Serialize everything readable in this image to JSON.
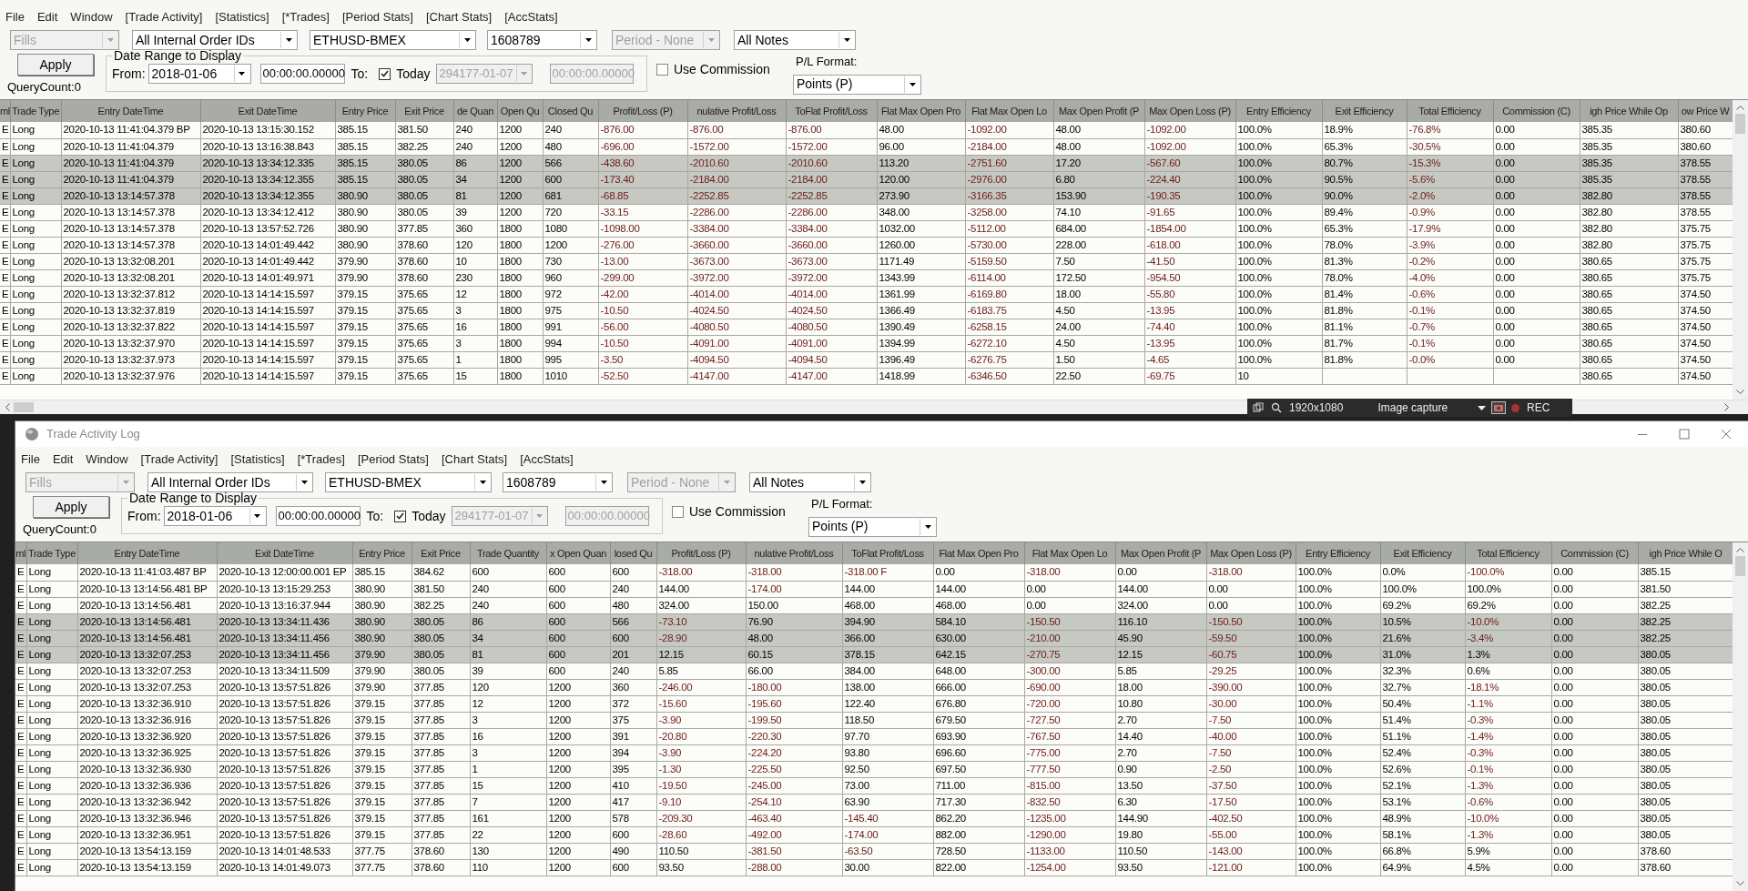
{
  "windows": [
    {
      "menu": [
        "File",
        "Edit",
        "Window",
        "[Trade Activity]",
        "[Statistics]",
        "[*Trades]",
        "[Period Stats]",
        "[Chart Stats]",
        "[AccStats]"
      ],
      "filters": [
        {
          "value": "Fills",
          "disabled": true
        },
        {
          "value": "All Internal Order IDs",
          "disabled": false
        },
        {
          "value": "ETHUSD-BMEX",
          "disabled": false
        },
        {
          "value": "1608789",
          "disabled": false
        },
        {
          "value": "Period - None",
          "disabled": true
        },
        {
          "value": "All Notes",
          "disabled": false
        }
      ],
      "apply_button": "Apply",
      "query_count": "QueryCount:0",
      "date_range": {
        "title": "Date Range to Display",
        "from_label": "From:",
        "from_date": "2018-01-06",
        "from_time": "00:00:00.00000",
        "to_label": "To:",
        "today": {
          "label": "Today",
          "checked": true
        },
        "to_date": {
          "value": "294177-01-07",
          "disabled": true
        },
        "to_time": {
          "value": "00:00:00.00000",
          "disabled": true
        }
      },
      "use_commission": {
        "label": "Use Commission",
        "checked": false
      },
      "pl_format": {
        "label": "P/L Format:",
        "value": "Points (P)"
      },
      "table": {
        "columns": [
          "ml",
          "Trade Type",
          "Entry DateTime",
          "Exit DateTime",
          "Entry Price",
          "Exit Price",
          "de Quan",
          "Open Qu",
          "Closed Qu",
          "Profit/Loss (P)",
          "nulative Profit/Loss",
          "ToFlat Profit/Loss",
          "Flat Max Open Pro",
          "Flat Max Open Lo",
          "Max Open Profit (P",
          "Max Open Loss (P)",
          "Entry Efficiency",
          "Exit Efficiency",
          "Total Efficiency",
          "Commission (C)",
          "igh Price While Op",
          "ow Price W"
        ],
        "rows": [
          {
            "selected": false,
            "cells": [
              "E",
              "Long",
              "2020-10-13 11:41:04.379 BP",
              "2020-10-13 13:15:30.152",
              "385.15",
              "381.50",
              "240",
              "1200",
              "240",
              "-876.00",
              "-876.00",
              "-876.00",
              "48.00",
              "-1092.00",
              "48.00",
              "-1092.00",
              "100.0%",
              "18.9%",
              "-76.8%",
              "0.00",
              "385.35",
              "380.60"
            ]
          },
          {
            "selected": false,
            "cells": [
              "E",
              "Long",
              "2020-10-13 11:41:04.379",
              "2020-10-13 13:16:38.843",
              "385.15",
              "382.25",
              "240",
              "1200",
              "480",
              "-696.00",
              "-1572.00",
              "-1572.00",
              "96.00",
              "-2184.00",
              "48.00",
              "-1092.00",
              "100.0%",
              "65.3%",
              "-30.5%",
              "0.00",
              "385.35",
              "380.60"
            ]
          },
          {
            "selected": true,
            "cells": [
              "E",
              "Long",
              "2020-10-13 11:41:04.379",
              "2020-10-13 13:34:12.335",
              "385.15",
              "380.05",
              "86",
              "1200",
              "566",
              "-438.60",
              "-2010.60",
              "-2010.60",
              "113.20",
              "-2751.60",
              "17.20",
              "-567.60",
              "100.0%",
              "80.7%",
              "-15.3%",
              "0.00",
              "385.35",
              "378.55"
            ]
          },
          {
            "selected": true,
            "cells": [
              "E",
              "Long",
              "2020-10-13 11:41:04.379",
              "2020-10-13 13:34:12.355",
              "385.15",
              "380.05",
              "34",
              "1200",
              "600",
              "-173.40",
              "-2184.00",
              "-2184.00",
              "120.00",
              "-2976.00",
              "6.80",
              "-224.40",
              "100.0%",
              "90.5%",
              "-5.6%",
              "0.00",
              "385.35",
              "378.55"
            ]
          },
          {
            "selected": true,
            "cells": [
              "E",
              "Long",
              "2020-10-13 13:14:57.378",
              "2020-10-13 13:34:12.355",
              "380.90",
              "380.05",
              "81",
              "1200",
              "681",
              "-68.85",
              "-2252.85",
              "-2252.85",
              "273.90",
              "-3166.35",
              "153.90",
              "-190.35",
              "100.0%",
              "90.0%",
              "-2.0%",
              "0.00",
              "382.80",
              "378.55"
            ]
          },
          {
            "selected": false,
            "cells": [
              "E",
              "Long",
              "2020-10-13 13:14:57.378",
              "2020-10-13 13:34:12.412",
              "380.90",
              "380.05",
              "39",
              "1200",
              "720",
              "-33.15",
              "-2286.00",
              "-2286.00",
              "348.00",
              "-3258.00",
              "74.10",
              "-91.65",
              "100.0%",
              "89.4%",
              "-0.9%",
              "0.00",
              "382.80",
              "378.55"
            ]
          },
          {
            "selected": false,
            "cells": [
              "E",
              "Long",
              "2020-10-13 13:14:57.378",
              "2020-10-13 13:57:52.726",
              "380.90",
              "377.85",
              "360",
              "1800",
              "1080",
              "-1098.00",
              "-3384.00",
              "-3384.00",
              "1032.00",
              "-5112.00",
              "684.00",
              "-1854.00",
              "100.0%",
              "65.3%",
              "-17.9%",
              "0.00",
              "382.80",
              "375.75"
            ]
          },
          {
            "selected": false,
            "cells": [
              "E",
              "Long",
              "2020-10-13 13:14:57.378",
              "2020-10-13 14:01:49.442",
              "380.90",
              "378.60",
              "120",
              "1800",
              "1200",
              "-276.00",
              "-3660.00",
              "-3660.00",
              "1260.00",
              "-5730.00",
              "228.00",
              "-618.00",
              "100.0%",
              "78.0%",
              "-3.9%",
              "0.00",
              "382.80",
              "375.75"
            ]
          },
          {
            "selected": false,
            "cells": [
              "E",
              "Long",
              "2020-10-13 13:32:08.201",
              "2020-10-13 14:01:49.442",
              "379.90",
              "378.60",
              "10",
              "1800",
              "730",
              "-13.00",
              "-3673.00",
              "-3673.00",
              "1171.49",
              "-5159.50",
              "7.50",
              "-41.50",
              "100.0%",
              "81.3%",
              "-0.2%",
              "0.00",
              "380.65",
              "375.75"
            ]
          },
          {
            "selected": false,
            "cells": [
              "E",
              "Long",
              "2020-10-13 13:32:08.201",
              "2020-10-13 14:01:49.971",
              "379.90",
              "378.60",
              "230",
              "1800",
              "960",
              "-299.00",
              "-3972.00",
              "-3972.00",
              "1343.99",
              "-6114.00",
              "172.50",
              "-954.50",
              "100.0%",
              "78.0%",
              "-4.0%",
              "0.00",
              "380.65",
              "375.75"
            ]
          },
          {
            "selected": false,
            "cells": [
              "E",
              "Long",
              "2020-10-13 13:32:37.812",
              "2020-10-13 14:14:15.597",
              "379.15",
              "375.65",
              "12",
              "1800",
              "972",
              "-42.00",
              "-4014.00",
              "-4014.00",
              "1361.99",
              "-6169.80",
              "18.00",
              "-55.80",
              "100.0%",
              "81.4%",
              "-0.6%",
              "0.00",
              "380.65",
              "374.50"
            ]
          },
          {
            "selected": false,
            "cells": [
              "E",
              "Long",
              "2020-10-13 13:32:37.819",
              "2020-10-13 14:14:15.597",
              "379.15",
              "375.65",
              "3",
              "1800",
              "975",
              "-10.50",
              "-4024.50",
              "-4024.50",
              "1366.49",
              "-6183.75",
              "4.50",
              "-13.95",
              "100.0%",
              "81.8%",
              "-0.1%",
              "0.00",
              "380.65",
              "374.50"
            ]
          },
          {
            "selected": false,
            "cells": [
              "E",
              "Long",
              "2020-10-13 13:32:37.822",
              "2020-10-13 14:14:15.597",
              "379.15",
              "375.65",
              "16",
              "1800",
              "991",
              "-56.00",
              "-4080.50",
              "-4080.50",
              "1390.49",
              "-6258.15",
              "24.00",
              "-74.40",
              "100.0%",
              "81.1%",
              "-0.7%",
              "0.00",
              "380.65",
              "374.50"
            ]
          },
          {
            "selected": false,
            "cells": [
              "E",
              "Long",
              "2020-10-13 13:32:37.970",
              "2020-10-13 14:14:15.597",
              "379.15",
              "375.65",
              "3",
              "1800",
              "994",
              "-10.50",
              "-4091.00",
              "-4091.00",
              "1394.99",
              "-6272.10",
              "4.50",
              "-13.95",
              "100.0%",
              "81.7%",
              "-0.1%",
              "0.00",
              "380.65",
              "374.50"
            ]
          },
          {
            "selected": false,
            "cells": [
              "E",
              "Long",
              "2020-10-13 13:32:37.973",
              "2020-10-13 14:14:15.597",
              "379.15",
              "375.65",
              "1",
              "1800",
              "995",
              "-3.50",
              "-4094.50",
              "-4094.50",
              "1396.49",
              "-6276.75",
              "1.50",
              "-4.65",
              "100.0%",
              "81.8%",
              "-0.0%",
              "0.00",
              "380.65",
              "374.50"
            ]
          },
          {
            "selected": false,
            "cells": [
              "E",
              "Long",
              "2020-10-13 13:32:37.976",
              "2020-10-13 14:14:15.597",
              "379.15",
              "375.65",
              "15",
              "1800",
              "1010",
              "-52.50",
              "-4147.00",
              "-4147.00",
              "1418.99",
              "-6346.50",
              "22.50",
              "-69.75",
              "10",
              null,
              null,
              null,
              "380.65",
              "374.50"
            ]
          }
        ]
      }
    },
    {
      "title": "Trade Activity Log",
      "menu": [
        "File",
        "Edit",
        "Window",
        "[Trade Activity]",
        "[Statistics]",
        "[*Trades]",
        "[Period Stats]",
        "[Chart Stats]",
        "[AccStats]"
      ],
      "filters": [
        {
          "value": "Fills",
          "disabled": true
        },
        {
          "value": "All Internal Order IDs",
          "disabled": false
        },
        {
          "value": "ETHUSD-BMEX",
          "disabled": false
        },
        {
          "value": "1608789",
          "disabled": false
        },
        {
          "value": "Period - None",
          "disabled": true
        },
        {
          "value": "All Notes",
          "disabled": false
        }
      ],
      "apply_button": "Apply",
      "query_count": "QueryCount:0",
      "date_range": {
        "title": "Date Range to Display",
        "from_label": "From:",
        "from_date": "2018-01-06",
        "from_time": "00:00:00.00000",
        "to_label": "To:",
        "today": {
          "label": "Today",
          "checked": true
        },
        "to_date": {
          "value": "294177-01-07",
          "disabled": true
        },
        "to_time": {
          "value": "00:00:00.00000",
          "disabled": true
        }
      },
      "use_commission": {
        "label": "Use Commission",
        "checked": false
      },
      "pl_format": {
        "label": "P/L Format:",
        "value": "Points (P)"
      },
      "table": {
        "columns": [
          "ml",
          "Trade Type",
          "Entry DateTime",
          "Exit DateTime",
          "Entry Price",
          "Exit Price",
          "Trade Quantity",
          "x Open Quan",
          "losed Qu",
          "Profit/Loss (P)",
          "nulative Profit/Loss",
          "ToFlat Profit/Loss",
          "Flat Max Open Pro",
          "Flat Max Open Lo",
          "Max Open Profit (P",
          "Max Open Loss (P)",
          "Entry Efficiency",
          "Exit Efficiency",
          "Total Efficiency",
          "Commission (C)",
          "igh Price While O"
        ],
        "rows": [
          {
            "selected": false,
            "cells": [
              "E",
              "Long",
              "2020-10-13 11:41:03.487 BP",
              "2020-10-13 12:00:00.001 EP",
              "385.15",
              "384.62",
              "600",
              "600",
              "600",
              "-318.00",
              "-318.00",
              "-318.00 F",
              "0.00",
              "-318.00",
              "0.00",
              "-318.00",
              "100.0%",
              "0.0%",
              "-100.0%",
              "0.00",
              "385.15"
            ]
          },
          {
            "selected": false,
            "cells": [
              "E",
              "Long",
              "2020-10-13 13:14:56.481 BP",
              "2020-10-13 13:15:29.253",
              "380.90",
              "381.50",
              "240",
              "600",
              "240",
              "144.00",
              "-174.00",
              "144.00",
              "144.00",
              "0.00",
              "144.00",
              "0.00",
              "100.0%",
              "100.0%",
              "100.0%",
              "0.00",
              "381.50"
            ]
          },
          {
            "selected": false,
            "cells": [
              "E",
              "Long",
              "2020-10-13 13:14:56.481",
              "2020-10-13 13:16:37.944",
              "380.90",
              "382.25",
              "240",
              "600",
              "480",
              "324.00",
              "150.00",
              "468.00",
              "468.00",
              "0.00",
              "324.00",
              "0.00",
              "100.0%",
              "69.2%",
              "69.2%",
              "0.00",
              "382.25"
            ]
          },
          {
            "selected": true,
            "cells": [
              "E",
              "Long",
              "2020-10-13 13:14:56.481",
              "2020-10-13 13:34:11.436",
              "380.90",
              "380.05",
              "86",
              "600",
              "566",
              "-73.10",
              "76.90",
              "394.90",
              "584.10",
              "-150.50",
              "116.10",
              "-150.50",
              "100.0%",
              "10.5%",
              "-10.0%",
              "0.00",
              "382.25"
            ]
          },
          {
            "selected": true,
            "cells": [
              "E",
              "Long",
              "2020-10-13 13:14:56.481",
              "2020-10-13 13:34:11.456",
              "380.90",
              "380.05",
              "34",
              "600",
              "600",
              "-28.90",
              "48.00",
              "366.00",
              "630.00",
              "-210.00",
              "45.90",
              "-59.50",
              "100.0%",
              "21.6%",
              "-3.4%",
              "0.00",
              "382.25"
            ]
          },
          {
            "selected": true,
            "cells": [
              "E",
              "Long",
              "2020-10-13 13:32:07.253",
              "2020-10-13 13:34:11.456",
              "379.90",
              "380.05",
              "81",
              "600",
              "201",
              "12.15",
              "60.15",
              "378.15",
              "642.15",
              "-270.75",
              "12.15",
              "-60.75",
              "100.0%",
              "31.0%",
              "1.3%",
              "0.00",
              "380.05"
            ]
          },
          {
            "selected": false,
            "cells": [
              "E",
              "Long",
              "2020-10-13 13:32:07.253",
              "2020-10-13 13:34:11.509",
              "379.90",
              "380.05",
              "39",
              "600",
              "240",
              "5.85",
              "66.00",
              "384.00",
              "648.00",
              "-300.00",
              "5.85",
              "-29.25",
              "100.0%",
              "32.3%",
              "0.6%",
              "0.00",
              "380.05"
            ]
          },
          {
            "selected": false,
            "cells": [
              "E",
              "Long",
              "2020-10-13 13:32:07.253",
              "2020-10-13 13:57:51.826",
              "379.90",
              "377.85",
              "120",
              "1200",
              "360",
              "-246.00",
              "-180.00",
              "138.00",
              "666.00",
              "-690.00",
              "18.00",
              "-390.00",
              "100.0%",
              "32.7%",
              "-18.1%",
              "0.00",
              "380.05"
            ]
          },
          {
            "selected": false,
            "cells": [
              "E",
              "Long",
              "2020-10-13 13:32:36.910",
              "2020-10-13 13:57:51.826",
              "379.15",
              "377.85",
              "12",
              "1200",
              "372",
              "-15.60",
              "-195.60",
              "122.40",
              "676.80",
              "-720.00",
              "10.80",
              "-30.00",
              "100.0%",
              "50.4%",
              "-1.1%",
              "0.00",
              "380.05"
            ]
          },
          {
            "selected": false,
            "cells": [
              "E",
              "Long",
              "2020-10-13 13:32:36.916",
              "2020-10-13 13:57:51.826",
              "379.15",
              "377.85",
              "3",
              "1200",
              "375",
              "-3.90",
              "-199.50",
              "118.50",
              "679.50",
              "-727.50",
              "2.70",
              "-7.50",
              "100.0%",
              "51.4%",
              "-0.3%",
              "0.00",
              "380.05"
            ]
          },
          {
            "selected": false,
            "cells": [
              "E",
              "Long",
              "2020-10-13 13:32:36.920",
              "2020-10-13 13:57:51.826",
              "379.15",
              "377.85",
              "16",
              "1200",
              "391",
              "-20.80",
              "-220.30",
              "97.70",
              "693.90",
              "-767.50",
              "14.40",
              "-40.00",
              "100.0%",
              "51.1%",
              "-1.4%",
              "0.00",
              "380.05"
            ]
          },
          {
            "selected": false,
            "cells": [
              "E",
              "Long",
              "2020-10-13 13:32:36.925",
              "2020-10-13 13:57:51.826",
              "379.15",
              "377.85",
              "3",
              "1200",
              "394",
              "-3.90",
              "-224.20",
              "93.80",
              "696.60",
              "-775.00",
              "2.70",
              "-7.50",
              "100.0%",
              "52.4%",
              "-0.3%",
              "0.00",
              "380.05"
            ]
          },
          {
            "selected": false,
            "cells": [
              "E",
              "Long",
              "2020-10-13 13:32:36.930",
              "2020-10-13 13:57:51.826",
              "379.15",
              "377.85",
              "1",
              "1200",
              "395",
              "-1.30",
              "-225.50",
              "92.50",
              "697.50",
              "-777.50",
              "0.90",
              "-2.50",
              "100.0%",
              "52.6%",
              "-0.1%",
              "0.00",
              "380.05"
            ]
          },
          {
            "selected": false,
            "cells": [
              "E",
              "Long",
              "2020-10-13 13:32:36.936",
              "2020-10-13 13:57:51.826",
              "379.15",
              "377.85",
              "15",
              "1200",
              "410",
              "-19.50",
              "-245.00",
              "73.00",
              "711.00",
              "-815.00",
              "13.50",
              "-37.50",
              "100.0%",
              "52.1%",
              "-1.3%",
              "0.00",
              "380.05"
            ]
          },
          {
            "selected": false,
            "cells": [
              "E",
              "Long",
              "2020-10-13 13:32:36.942",
              "2020-10-13 13:57:51.826",
              "379.15",
              "377.85",
              "7",
              "1200",
              "417",
              "-9.10",
              "-254.10",
              "63.90",
              "717.30",
              "-832.50",
              "6.30",
              "-17.50",
              "100.0%",
              "53.1%",
              "-0.6%",
              "0.00",
              "380.05"
            ]
          },
          {
            "selected": false,
            "cells": [
              "E",
              "Long",
              "2020-10-13 13:32:36.946",
              "2020-10-13 13:57:51.826",
              "379.15",
              "377.85",
              "161",
              "1200",
              "578",
              "-209.30",
              "-463.40",
              "-145.40",
              "862.20",
              "-1235.00",
              "144.90",
              "-402.50",
              "100.0%",
              "48.9%",
              "-10.0%",
              "0.00",
              "380.05"
            ]
          },
          {
            "selected": false,
            "cells": [
              "E",
              "Long",
              "2020-10-13 13:32:36.951",
              "2020-10-13 13:57:51.826",
              "379.15",
              "377.85",
              "22",
              "1200",
              "600",
              "-28.60",
              "-492.00",
              "-174.00",
              "882.00",
              "-1290.00",
              "19.80",
              "-55.00",
              "100.0%",
              "58.1%",
              "-1.3%",
              "0.00",
              "380.05"
            ]
          },
          {
            "selected": false,
            "cells": [
              "E",
              "Long",
              "2020-10-13 13:54:13.159",
              "2020-10-13 14:01:48.533",
              "377.75",
              "378.60",
              "130",
              "1200",
              "490",
              "110.50",
              "-381.50",
              "-63.50",
              "728.50",
              "-1133.00",
              "110.50",
              "-143.00",
              "100.0%",
              "66.8%",
              "5.9%",
              "0.00",
              "378.60"
            ]
          },
          {
            "selected": false,
            "cells": [
              "E",
              "Long",
              "2020-10-13 13:54:13.159",
              "2020-10-13 14:01:49.073",
              "377.75",
              "378.60",
              "110",
              "1200",
              "600",
              "93.50",
              "-288.00",
              "30.00",
              "822.00",
              "-1254.00",
              "93.50",
              "-121.00",
              "100.0%",
              "64.9%",
              "4.5%",
              "0.00",
              "378.60"
            ]
          }
        ]
      }
    }
  ],
  "capture_toolbar": {
    "resolution": "1920x1080",
    "mode": "Image capture",
    "record": "REC"
  }
}
